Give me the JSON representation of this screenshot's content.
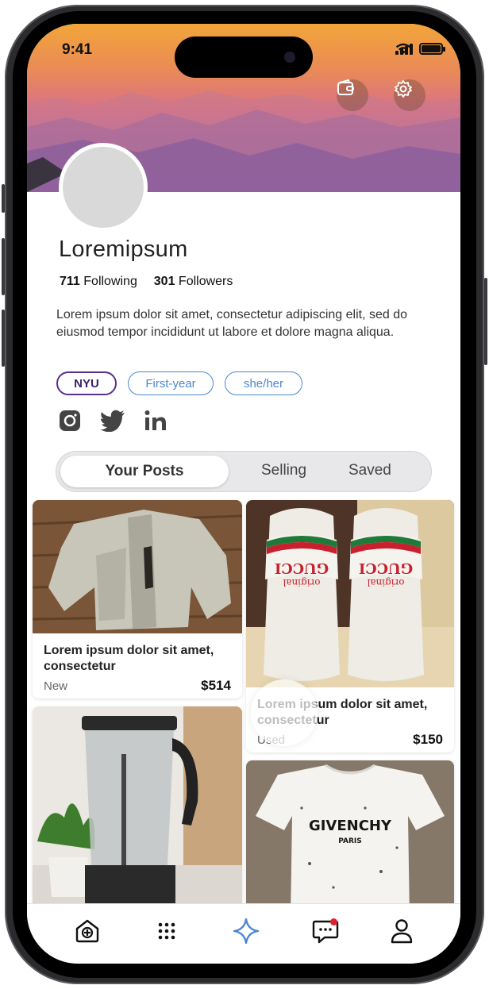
{
  "status_bar": {
    "time": "9:41"
  },
  "header": {
    "icons": [
      "wallet-icon",
      "gear-icon"
    ]
  },
  "profile": {
    "name": "Loremipsum",
    "following_count": "711",
    "following_label": "Following",
    "followers_count": "301",
    "followers_label": "Followers",
    "bio": "Lorem ipsum dolor sit amet, consectetur adipiscing elit, sed do eiusmod tempor incididunt ut labore et dolore magna aliqua.",
    "tags": [
      "NYU",
      "First-year",
      "she/her"
    ],
    "socials": [
      "instagram-icon",
      "twitter-icon",
      "linkedin-icon"
    ]
  },
  "tabs": {
    "active": "Your Posts",
    "items": [
      "Your Posts",
      "Selling",
      "Saved"
    ]
  },
  "posts": [
    {
      "title": "Lorem ipsum dolor sit amet, consectetur",
      "condition": "New",
      "price": "$514",
      "image": "jacket"
    },
    {
      "title": "Lorem ipsum dolor sit amet, consectetur",
      "condition": "Used",
      "price": "$150",
      "image": "slides"
    },
    {
      "title": "",
      "condition": "",
      "price": "",
      "image": "blender"
    },
    {
      "title": "",
      "condition": "",
      "price": "",
      "image": "tshirt"
    }
  ],
  "product_prints": {
    "slides_text": "GUCCI",
    "slides_subtext": "original",
    "tshirt_brand": "GIVENCHY",
    "tshirt_city": "PARIS"
  },
  "bottom_nav": {
    "items": [
      "home-icon",
      "grid-icon",
      "sparkle-icon",
      "messages-icon",
      "profile-icon"
    ],
    "active": "sparkle-icon",
    "accent": "#4b86d1",
    "unread_dot_color": "#e0202f"
  }
}
